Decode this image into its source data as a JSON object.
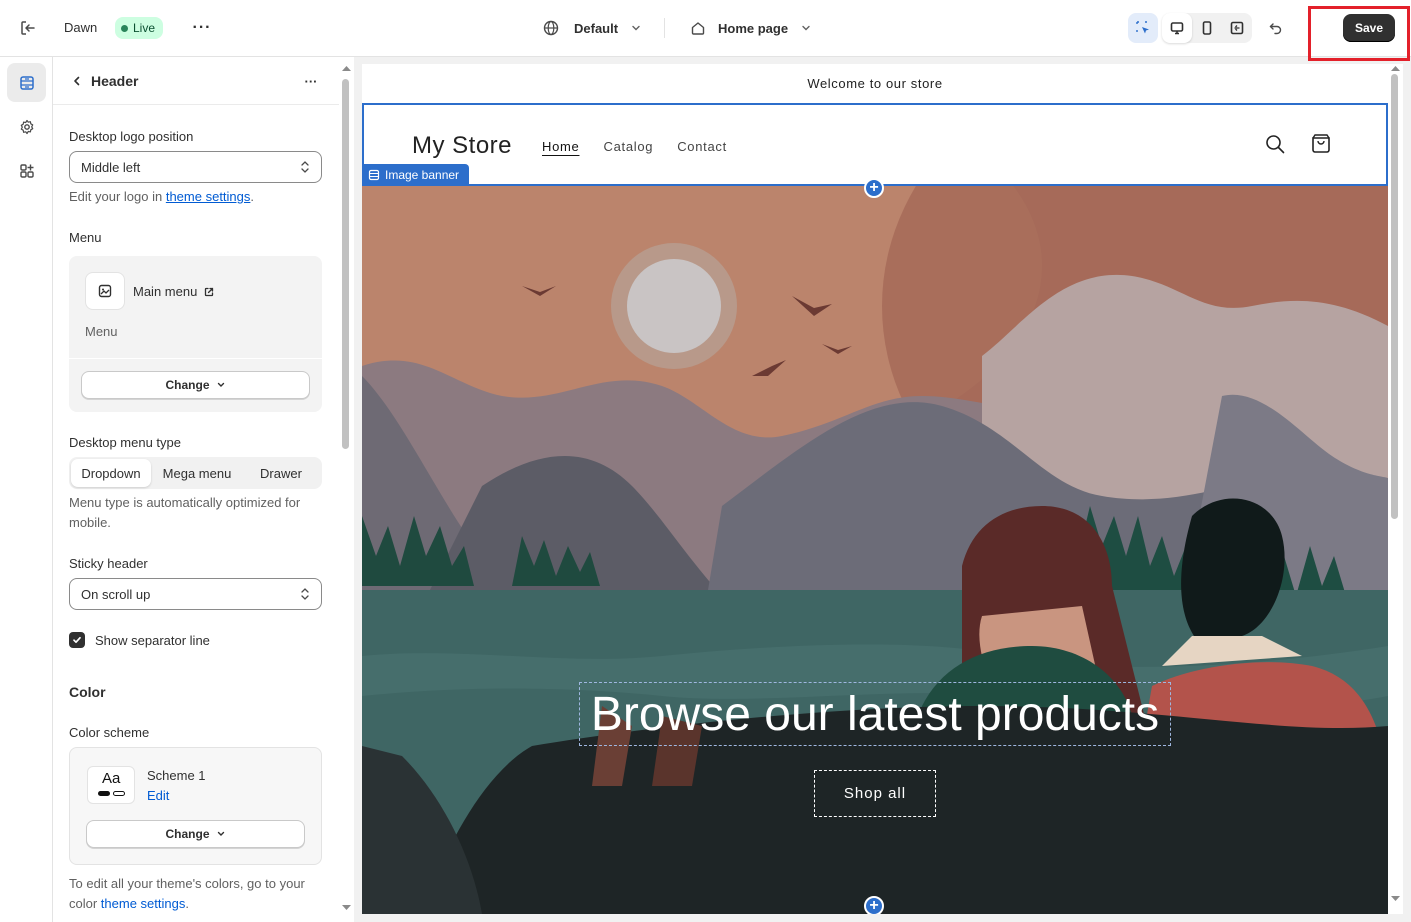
{
  "topbar": {
    "theme_name": "Dawn",
    "live_label": "Live",
    "default_label": "Default",
    "page_label": "Home page",
    "save_label": "Save"
  },
  "panel": {
    "title": "Header",
    "logo_position_label": "Desktop logo position",
    "logo_position_value": "Middle left",
    "logo_help_prefix": "Edit your logo in ",
    "logo_help_link": "theme settings",
    "logo_help_suffix": ".",
    "menu_label": "Menu",
    "menu_name": "Main menu",
    "menu_sub": "Menu",
    "menu_change": "Change",
    "menu_type_label": "Desktop menu type",
    "menu_types": [
      "Dropdown",
      "Mega menu",
      "Drawer"
    ],
    "menu_type_selected": "Dropdown",
    "menu_type_help": "Menu type is automatically optimized for mobile.",
    "sticky_label": "Sticky header",
    "sticky_value": "On scroll up",
    "separator_label": "Show separator line",
    "separator_checked": true,
    "color_heading": "Color",
    "color_scheme_label": "Color scheme",
    "scheme_preview": "Aa",
    "scheme_name": "Scheme 1",
    "scheme_edit": "Edit",
    "scheme_change": "Change",
    "colors_help_prefix": "To edit all your theme's colors, go to your color ",
    "colors_help_link": "theme settings",
    "colors_help_suffix": "."
  },
  "preview": {
    "announcement": "Welcome to our store",
    "store_name": "My Store",
    "nav": [
      "Home",
      "Catalog",
      "Contact"
    ],
    "section_tag": "Image banner",
    "banner_heading": "Browse our latest products",
    "banner_button": "Shop all"
  },
  "colors": {
    "accent": "#2c6ecb",
    "save_bg": "#303030",
    "highlight": "#e3202a"
  }
}
